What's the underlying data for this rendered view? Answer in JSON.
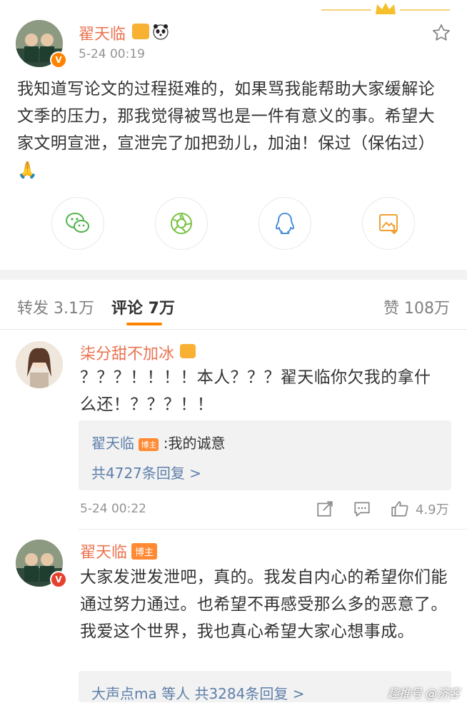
{
  "post": {
    "author": "翟天临",
    "time": "5-24 00:19",
    "text": "我知道写论文的过程挺难的，如果骂我能帮助大家缓解论文季的压力，那我觉得被骂也是一件有意义的事。希望大家文明宣泄，宣泄完了加把劲儿，加油！保过（保佑过）🙏",
    "share_icons": [
      "wechat-icon",
      "moments-icon",
      "qq-icon",
      "save-image-icon"
    ]
  },
  "tabs": {
    "repost": "转发 3.1万",
    "comment": "评论 7万",
    "like": "赞 108万"
  },
  "comments": [
    {
      "author": "柒分甜不加冰",
      "text": "？？？！！！！本人？？？翟天临你欠我的拿什么还！？？？！！",
      "reply_author": "翟天临",
      "reply_badge": "博主",
      "reply_text": ":我的诚意",
      "reply_more": "共4727条回复 >",
      "time": "5-24 00:22",
      "likes": "4.9万"
    },
    {
      "author": "翟天临",
      "badge": "博主",
      "text": "大家发泄发泄吧，真的。我发自内心的希望你们能通过努力通过。也希望不再感受那么多的恶意了。我爱这个世界，我也真心希望大家心想事成。",
      "reply_summary": "大声点ma 等人  共3284条回复 >"
    }
  ],
  "watermark": "趣推号 @济客",
  "colors": {
    "name": "#eb7350",
    "link": "#5d7faa",
    "accent": "#ff8200",
    "bg_gray": "#f2f2f2"
  }
}
